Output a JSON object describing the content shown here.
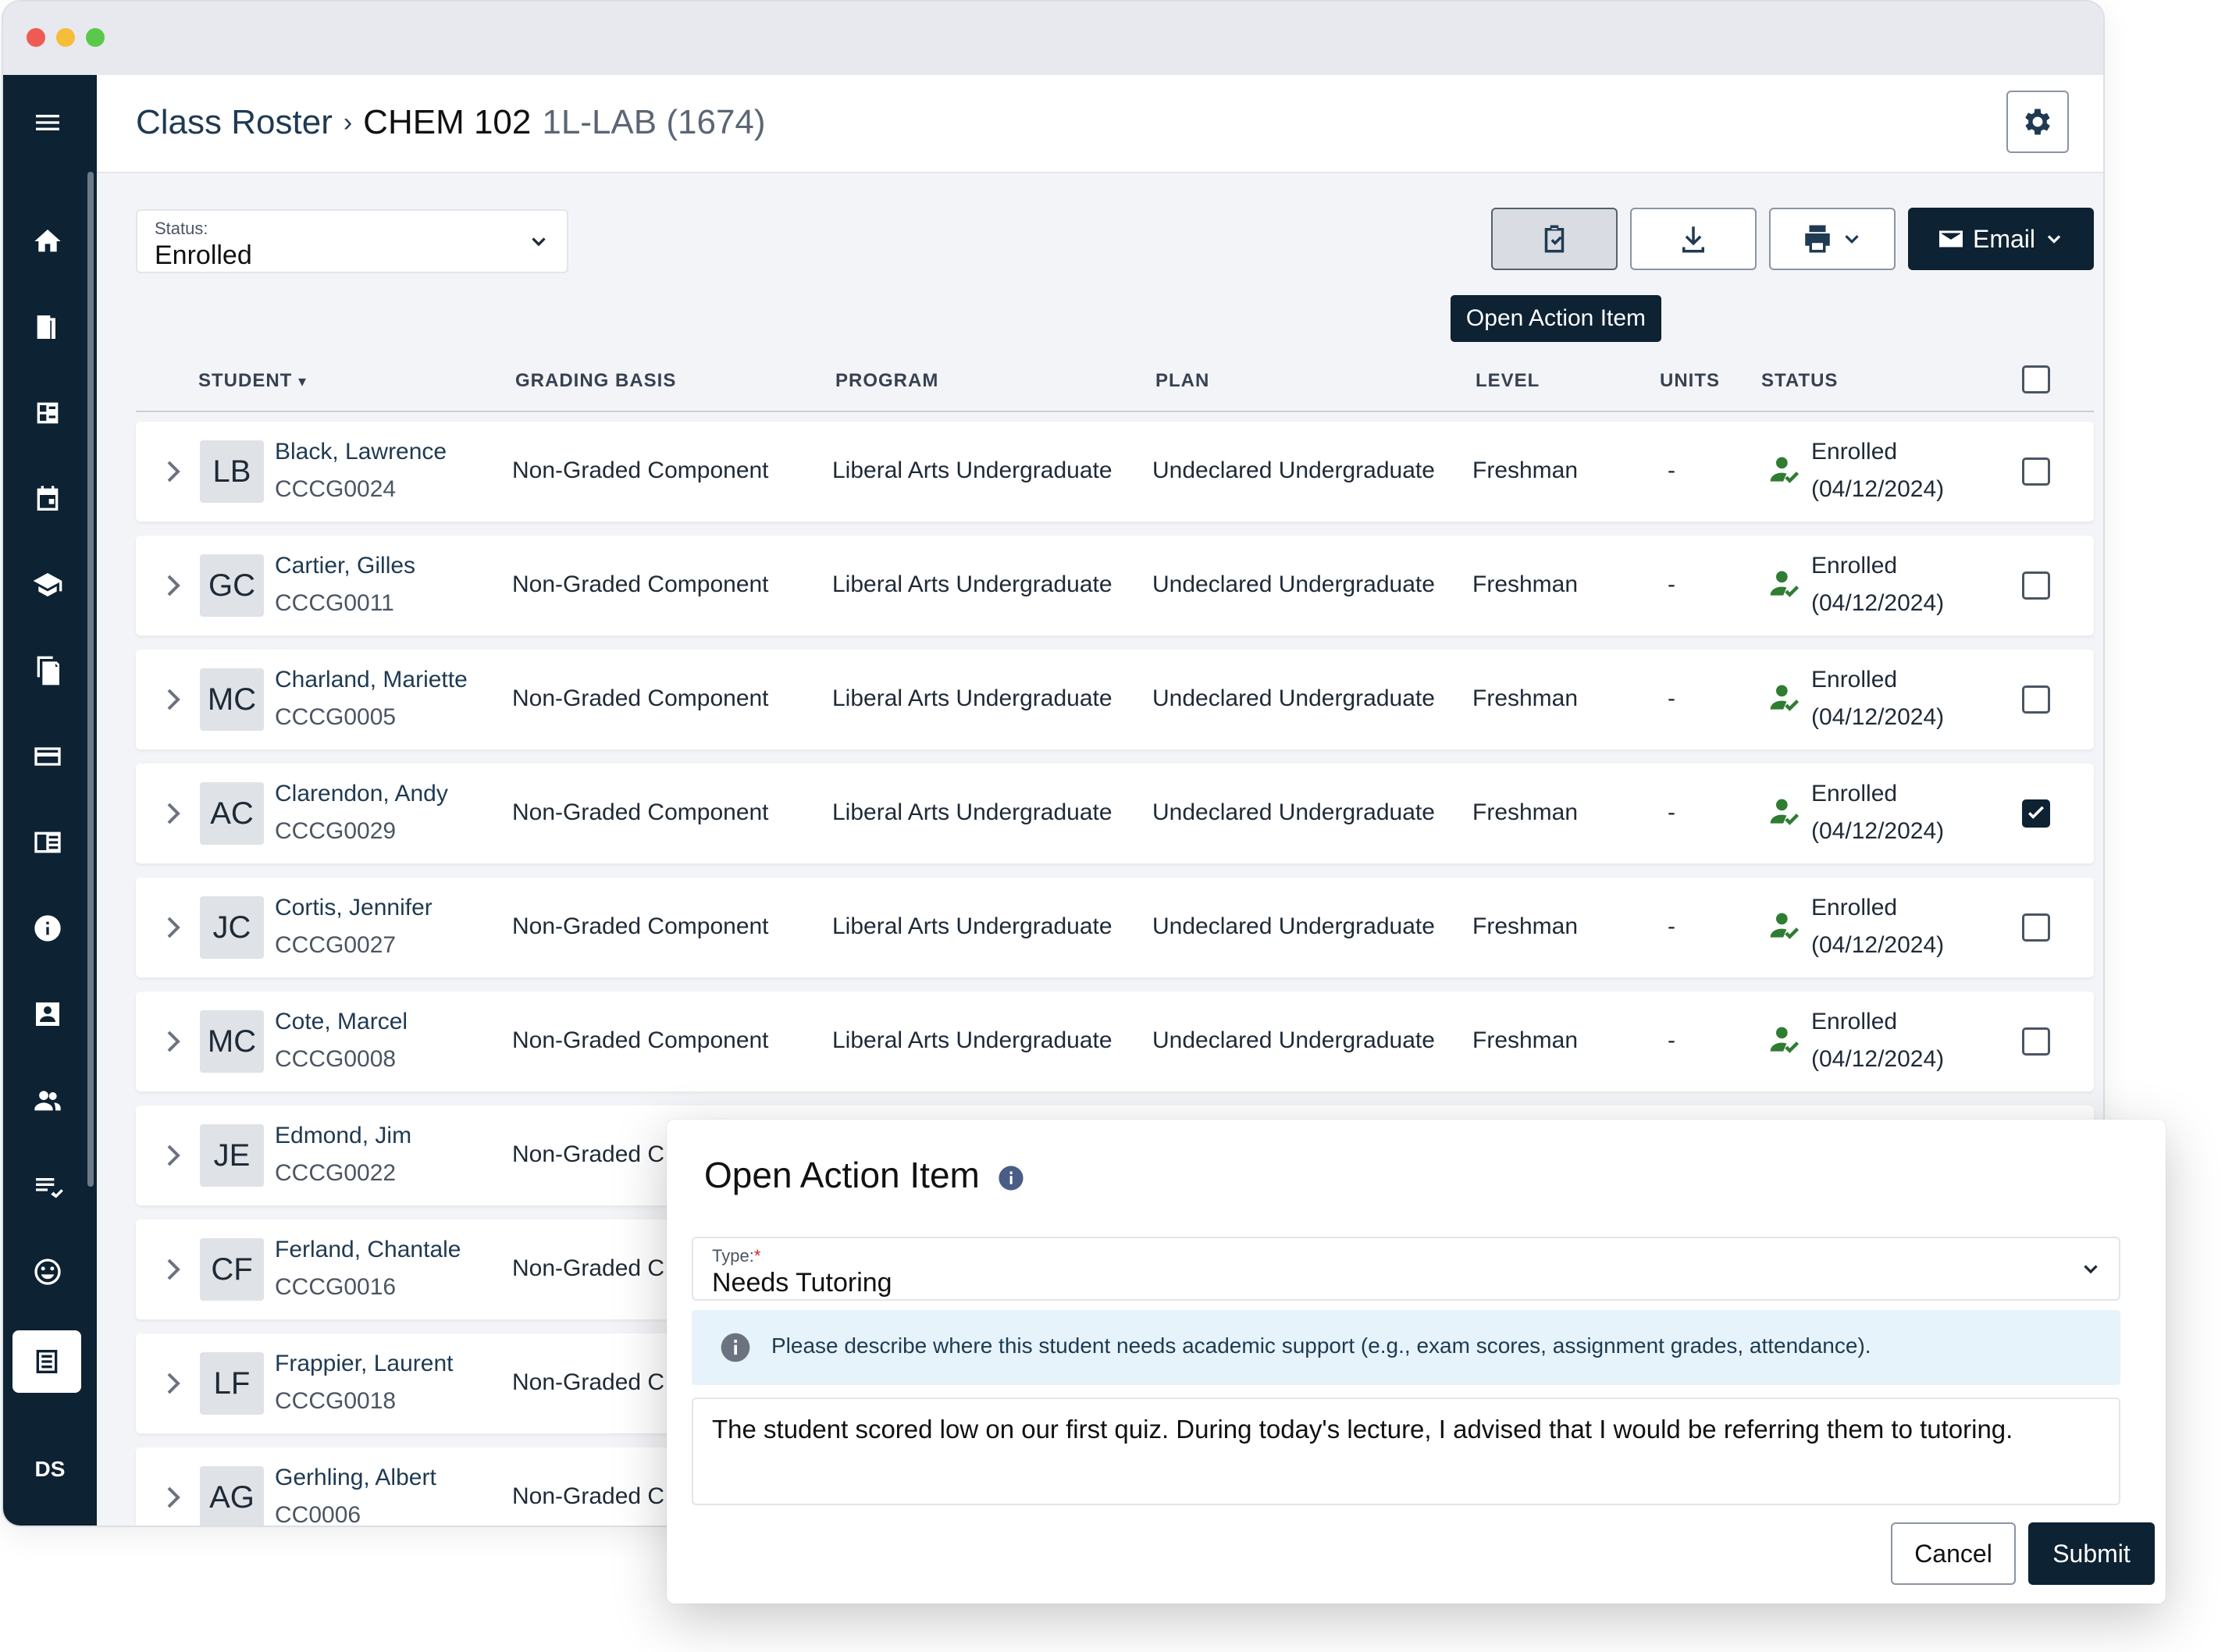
{
  "breadcrumb": {
    "root": "Class Roster",
    "course": "CHEM 102",
    "section": "1L-LAB (1674)"
  },
  "status_filter": {
    "label": "Status:",
    "value": "Enrolled"
  },
  "toolbar": {
    "email_label": "Email",
    "tooltip": "Open Action Item"
  },
  "table": {
    "headers": {
      "student": "STUDENT",
      "grading": "GRADING BASIS",
      "program": "PROGRAM",
      "plan": "PLAN",
      "level": "LEVEL",
      "units": "UNITS",
      "status": "STATUS"
    },
    "rows": [
      {
        "initials": "LB",
        "name": "Black, Lawrence",
        "id": "CCCG0024",
        "grading": "Non-Graded Component",
        "program": "Liberal Arts Undergraduate",
        "plan": "Undeclared Undergraduate",
        "level": "Freshman",
        "units": "-",
        "status": "Enrolled",
        "date": "(04/12/2024)",
        "checked": false
      },
      {
        "initials": "GC",
        "name": "Cartier, Gilles",
        "id": "CCCG0011",
        "grading": "Non-Graded Component",
        "program": "Liberal Arts Undergraduate",
        "plan": "Undeclared Undergraduate",
        "level": "Freshman",
        "units": "-",
        "status": "Enrolled",
        "date": "(04/12/2024)",
        "checked": false
      },
      {
        "initials": "MC",
        "name": "Charland, Mariette",
        "id": "CCCG0005",
        "grading": "Non-Graded Component",
        "program": "Liberal Arts Undergraduate",
        "plan": "Undeclared Undergraduate",
        "level": "Freshman",
        "units": "-",
        "status": "Enrolled",
        "date": "(04/12/2024)",
        "checked": false
      },
      {
        "initials": "AC",
        "name": "Clarendon, Andy",
        "id": "CCCG0029",
        "grading": "Non-Graded Component",
        "program": "Liberal Arts Undergraduate",
        "plan": "Undeclared Undergraduate",
        "level": "Freshman",
        "units": "-",
        "status": "Enrolled",
        "date": "(04/12/2024)",
        "checked": true
      },
      {
        "initials": "JC",
        "name": "Cortis, Jennifer",
        "id": "CCCG0027",
        "grading": "Non-Graded Component",
        "program": "Liberal Arts Undergraduate",
        "plan": "Undeclared Undergraduate",
        "level": "Freshman",
        "units": "-",
        "status": "Enrolled",
        "date": "(04/12/2024)",
        "checked": false
      },
      {
        "initials": "MC",
        "name": "Cote, Marcel",
        "id": "CCCG0008",
        "grading": "Non-Graded Component",
        "program": "Liberal Arts Undergraduate",
        "plan": "Undeclared Undergraduate",
        "level": "Freshman",
        "units": "-",
        "status": "Enrolled",
        "date": "(04/12/2024)",
        "checked": false
      },
      {
        "initials": "JE",
        "name": "Edmond, Jim",
        "id": "CCCG0022",
        "grading": "Non-Graded C"
      },
      {
        "initials": "CF",
        "name": "Ferland, Chantale",
        "id": "CCCG0016",
        "grading": "Non-Graded C"
      },
      {
        "initials": "LF",
        "name": "Frappier, Laurent",
        "id": "CCCG0018",
        "grading": "Non-Graded C"
      },
      {
        "initials": "AG",
        "name": "Gerhling, Albert",
        "id": "CC0006",
        "grading": "Non-Graded C"
      }
    ]
  },
  "user_initials": "DS",
  "modal": {
    "title": "Open Action Item",
    "type_label": "Type:",
    "type_required": "*",
    "type_value": "Needs Tutoring",
    "notice": "Please describe where this student needs academic support (e.g., exam scores, assignment grades, attendance).",
    "comment": "The student scored low on our first quiz. During today's lecture, I advised that I would be referring them to tutoring.",
    "cancel_label": "Cancel",
    "submit_label": "Submit"
  },
  "colors": {
    "navy": "#0d2233",
    "success_green": "#2e7d32",
    "notice_bg": "#e6f3fa"
  }
}
